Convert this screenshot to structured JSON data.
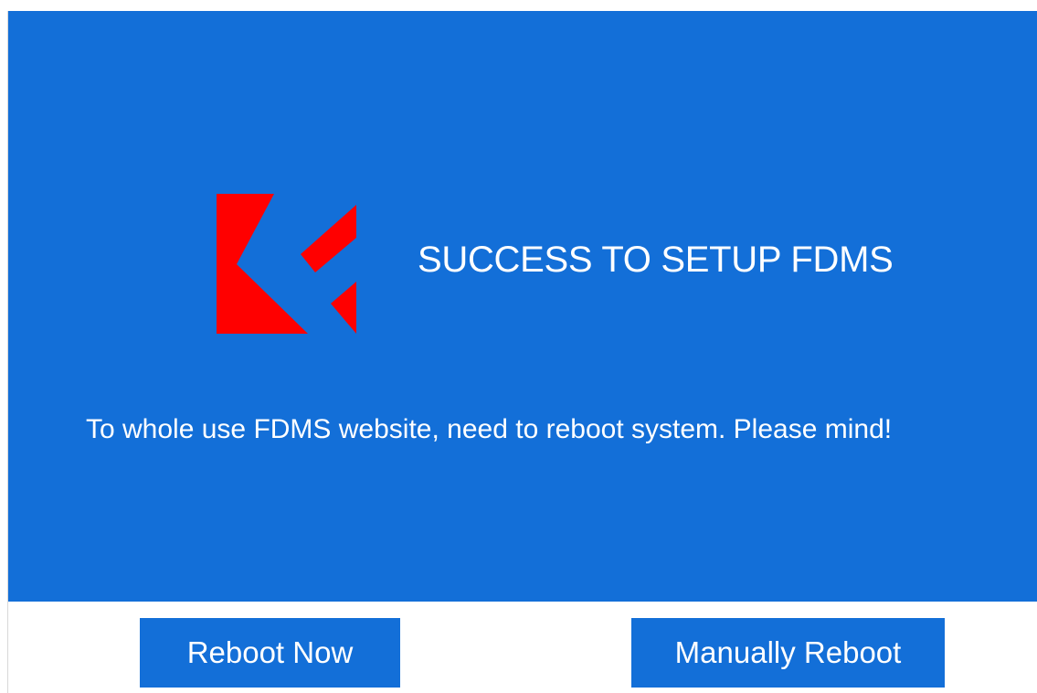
{
  "dialog": {
    "title": "SUCCESS TO SETUP FDMS",
    "message": "To whole use FDMS website, need to reboot system. Please mind!",
    "logo_icon": "fdms-logo-icon"
  },
  "buttons": {
    "reboot_now_label": "Reboot Now",
    "manual_reboot_label": "Manually Reboot"
  },
  "colors": {
    "banner": "#136fd8",
    "logo_red": "#ff0000",
    "button": "#136fd8",
    "text": "#ffffff",
    "background": "#ffffff"
  }
}
